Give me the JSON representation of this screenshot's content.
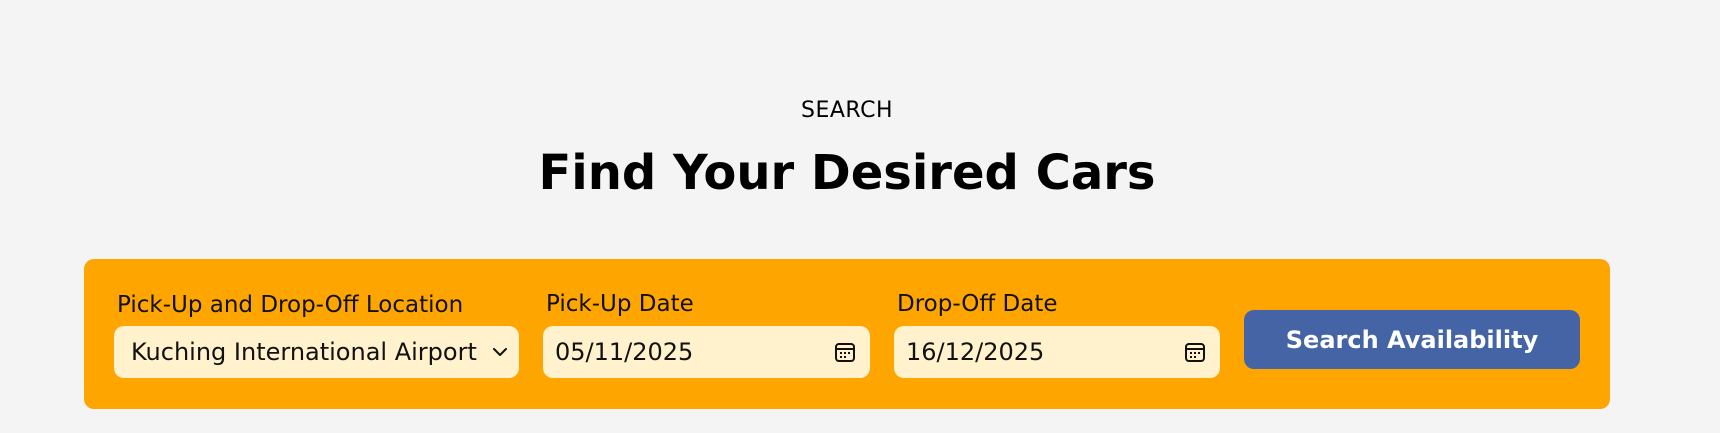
{
  "header": {
    "eyebrow": "SEARCH",
    "title": "Find Your Desired Cars"
  },
  "search_form": {
    "location_label": "Pick-Up and Drop-Off Location",
    "location_value": "Kuching International Airport",
    "pickup_label": "Pick-Up Date",
    "pickup_value": "05/11/2025",
    "dropoff_label": "Drop-Off Date",
    "dropoff_value": "16/12/2025",
    "submit_label": "Search Availability"
  },
  "icons": {
    "location_dropdown": "chevron-down-icon",
    "pickup_calendar": "calendar-icon",
    "dropoff_calendar": "calendar-icon"
  },
  "colors": {
    "background": "#f4f4f4",
    "panel": "#ffa500",
    "field": "#fff2cc",
    "button": "#4464a6",
    "button_text": "#ffffff"
  }
}
